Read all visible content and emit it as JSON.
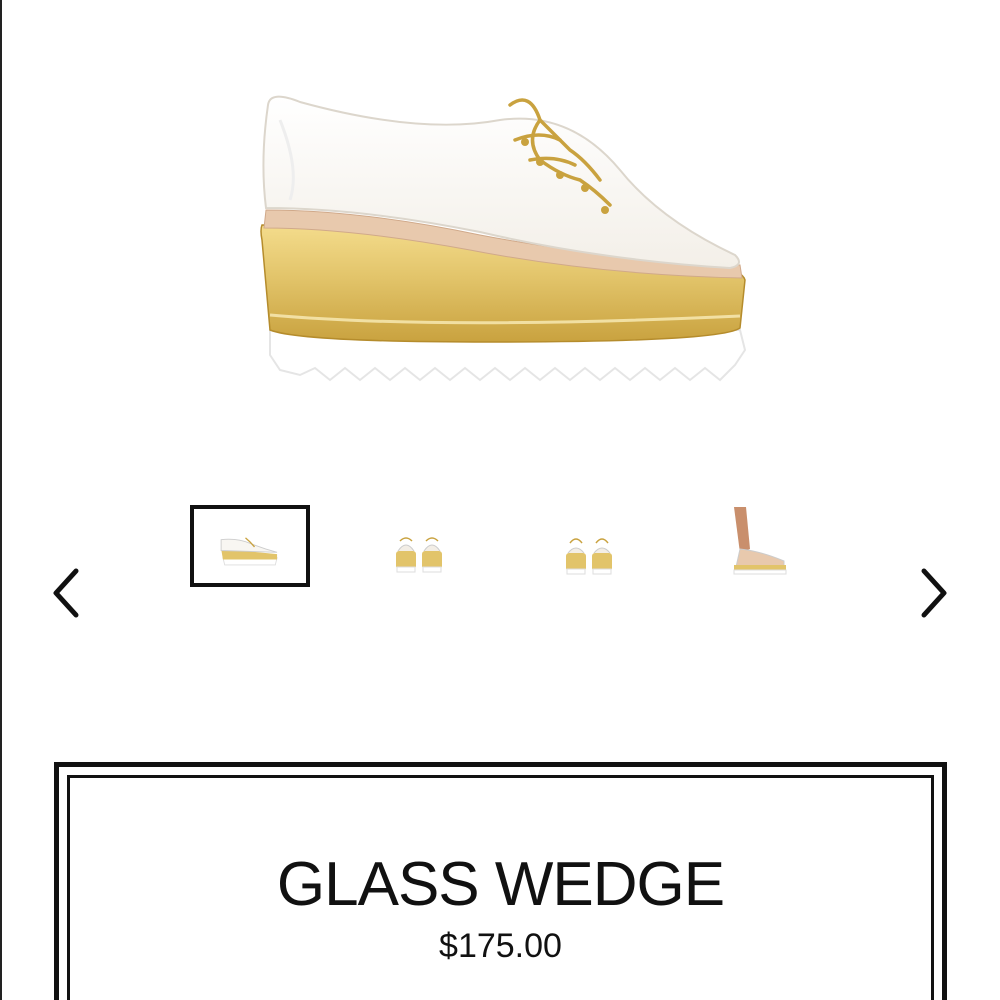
{
  "product": {
    "title": "GLASS WEDGE",
    "price": "$175.00"
  },
  "gallery": {
    "prev_icon": "chevron-left-icon",
    "next_icon": "chevron-right-icon",
    "selected_index": 0,
    "thumbnail_count": 4
  },
  "colors": {
    "border": "#111111",
    "gold": "#e2c46a",
    "gold_dark": "#c9a23f",
    "sole": "#ffffff",
    "tan": "#e8c9ad",
    "skin": "#c98f6c"
  }
}
